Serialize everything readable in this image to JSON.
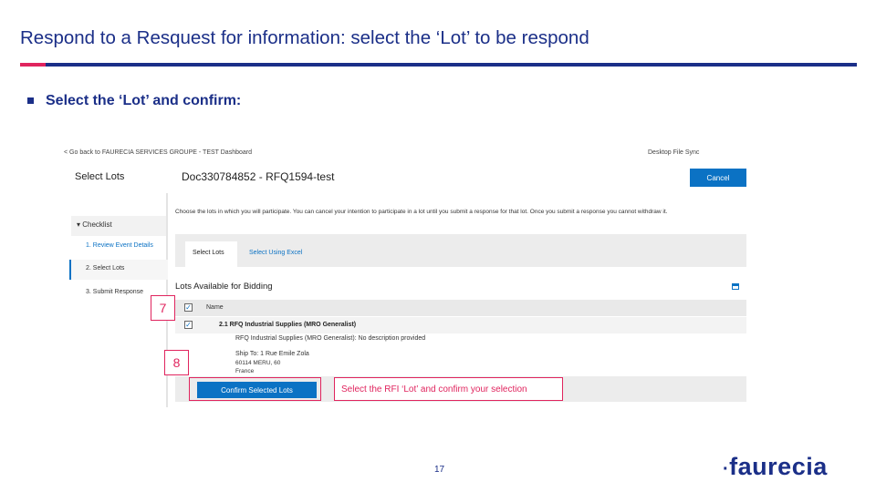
{
  "slide": {
    "title": "Respond to a Resquest for information: select the ‘Lot’ to be respond",
    "bullet": "Select the ‘Lot’ and confirm:",
    "page_number": "17",
    "logo_text": "faurecia",
    "colors": {
      "title_blue": "#1b2f88",
      "accent_pink": "#e0245e",
      "ui_blue": "#0b72c4"
    }
  },
  "screenshot": {
    "back_link": "< Go back to FAURECIA SERVICES GROUPE - TEST Dashboard",
    "desktop_sync": "Desktop File Sync",
    "page_heading": "Select Lots",
    "doc_title": "Doc330784852 - RFQ1594-test",
    "cancel_label": "Cancel",
    "sidebar": {
      "checklist_label": "▾ Checklist",
      "steps": [
        "1. Review Event Details",
        "2. Select Lots",
        "3. Submit Response"
      ]
    },
    "instruction": "Choose the lots in which you will participate. You can cancel your intention to participate in a lot until you submit a response for that lot. Once you submit a response you cannot withdraw it.",
    "tabs": [
      "Select Lots",
      "Select Using Excel"
    ],
    "lots_title": "Lots Available for Bidding",
    "table": {
      "column_name": "Name",
      "row": {
        "lot_name": "2.1   RFQ Industrial Supplies (MRO Generalist)",
        "description": "RFQ Industrial Supplies (MRO Generalist): No description provided",
        "address_1": "Ship To: 1 Rue Emile Zola",
        "address_2": "60114 MERU, 60",
        "address_3": "France"
      }
    },
    "confirm_label": "Confirm Selected Lots",
    "checkmark": "✓"
  },
  "annotations": {
    "badge_7": "7",
    "badge_8": "8",
    "callout": "Select the RFI ‘Lot’ and confirm your selection"
  }
}
